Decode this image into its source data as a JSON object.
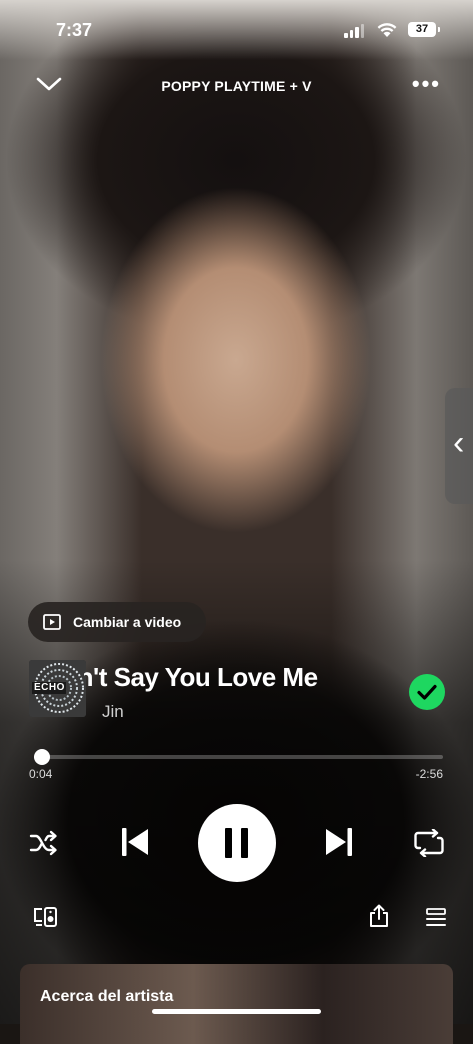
{
  "status_bar": {
    "time": "7:37",
    "battery": "37"
  },
  "header": {
    "title": "POPPY PLAYTIME + V"
  },
  "video_toggle": {
    "label": "Cambiar a video"
  },
  "track": {
    "album_art_text": "ECHO",
    "title": "Don't Say You Love Me",
    "artist": "Jin",
    "liked": true
  },
  "progress": {
    "elapsed": "0:04",
    "remaining": "-2:56",
    "fraction": 0.02
  },
  "playback": {
    "state": "playing",
    "shuffle": false,
    "repeat": false
  },
  "about": {
    "label": "Acerca del artista"
  },
  "colors": {
    "accent": "#1ed760",
    "text": "#ffffff"
  },
  "icons": [
    "chevron-down-icon",
    "more-icon",
    "video-icon",
    "check-icon",
    "shuffle-icon",
    "previous-icon",
    "pause-icon",
    "next-icon",
    "repeat-icon",
    "devices-icon",
    "share-icon",
    "queue-icon",
    "side-chevron-icon"
  ]
}
